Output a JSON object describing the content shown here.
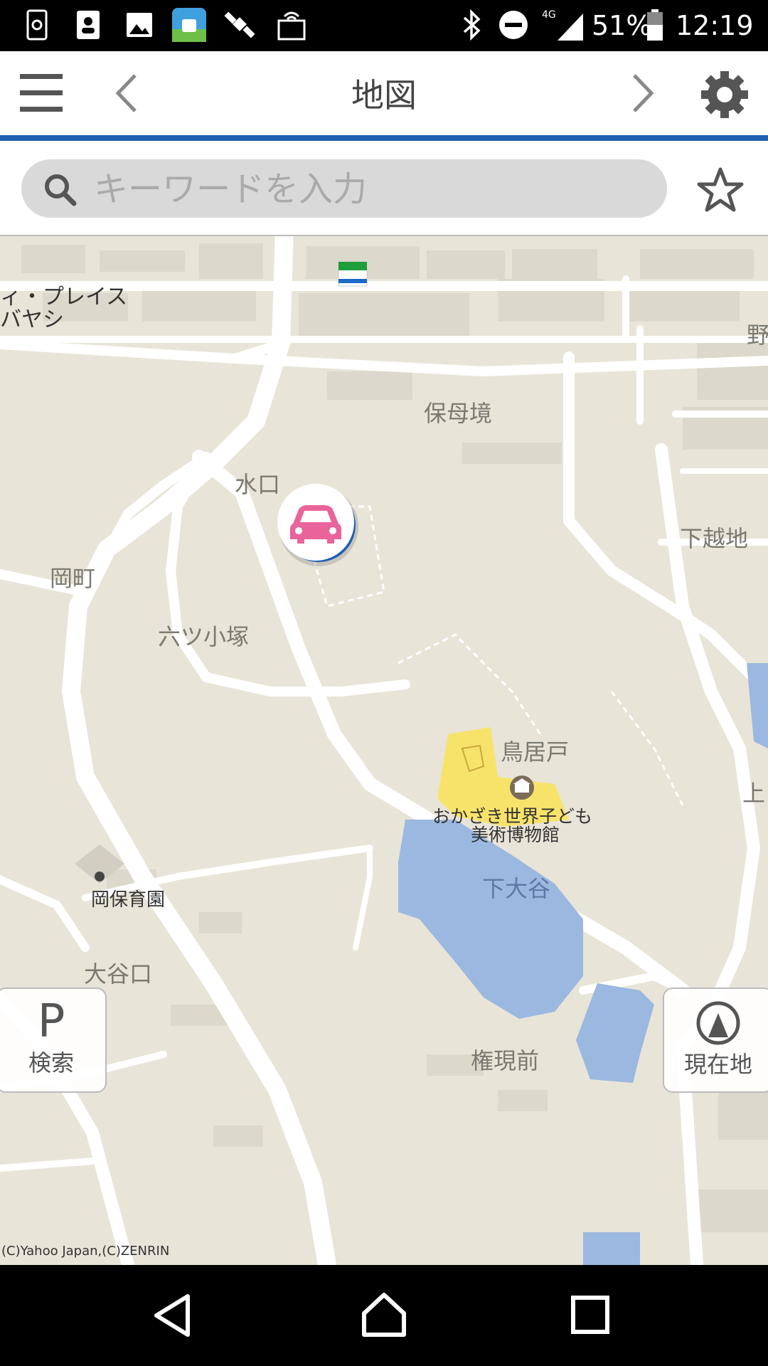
{
  "status_bar": {
    "battery_percent": "51%",
    "time": "12:19",
    "network": "4G"
  },
  "header": {
    "title": "地図"
  },
  "search": {
    "placeholder": "キーワードを入力"
  },
  "map": {
    "labels": {
      "place_ito": "ィ・プレイス",
      "place_bayashi": "バヤシ",
      "hobogai": "保母境",
      "mizuguchi": "水口",
      "okamachi": "岡町",
      "mutsu_kozuka": "六ツ小塚",
      "shimokoshiji": "下越地",
      "torido": "鳥居戸",
      "museum_line1": "おかざき世界子ども",
      "museum_line2": "美術博物館",
      "shimooya": "下大谷",
      "oka_hoikuen": "岡保育園",
      "oyaguchi": "大谷口",
      "gongenmae": "権現前",
      "no_edge": "野",
      "ue_edge": "上"
    },
    "copyright": "(C)Yahoo Japan,(C)ZENRIN",
    "familymart_label": "FamilyMart"
  },
  "buttons": {
    "parking_letter": "P",
    "parking_search": "検索",
    "current_location": "現在地"
  },
  "colors": {
    "accent": "#1f5fb2",
    "map_bg": "#e8e4d8",
    "road": "#ffffff",
    "water": "#9bb8e0",
    "museum": "#f7e36a",
    "car_pin": "#e8649a"
  }
}
